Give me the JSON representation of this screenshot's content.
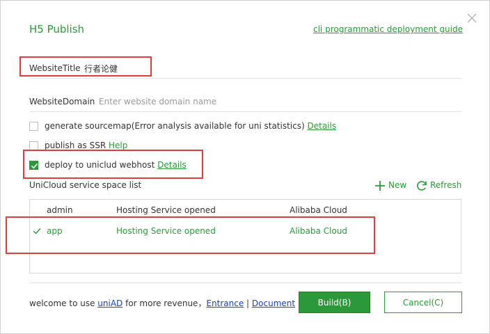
{
  "dialog": {
    "title": "H5 Publish",
    "guide_link": "cli programmatic deployment guide",
    "close_icon": "close-icon"
  },
  "website_title": {
    "label": "WebsiteTitle",
    "value": "行者论健"
  },
  "website_domain": {
    "label": "WebsiteDomain",
    "placeholder": "Enter website domain name",
    "value": ""
  },
  "options": [
    {
      "label": "generate sourcemap(Error analysis available for uni statistics)",
      "link": "Details",
      "checked": false
    },
    {
      "label": "publish as SSR",
      "link": "Help",
      "checked": false
    },
    {
      "label": "deploy to uniclud webhost",
      "link": "Details",
      "checked": true
    }
  ],
  "space_list": {
    "label": "UniCloud service space list",
    "new_label": "New",
    "refresh_label": "Refresh",
    "rows": [
      {
        "name": "admin",
        "status": "Hosting Service opened",
        "provider": "Alibaba Cloud",
        "selected": false
      },
      {
        "name": "app",
        "status": "Hosting Service opened",
        "provider": "Alibaba Cloud",
        "selected": true
      }
    ]
  },
  "footer": {
    "text_pre": "welcome to use ",
    "uniad_link": "uniAD",
    "text_mid": " for more revenue，",
    "entrance_link": "Entrance",
    "separator": "|",
    "document_link": "Document",
    "build_label": "Build(B)",
    "cancel_label": "Cancel(C)"
  },
  "colors": {
    "accent": "#2b9939",
    "annotation": "#e23b3b",
    "link_blue": "#1a3fbf"
  }
}
